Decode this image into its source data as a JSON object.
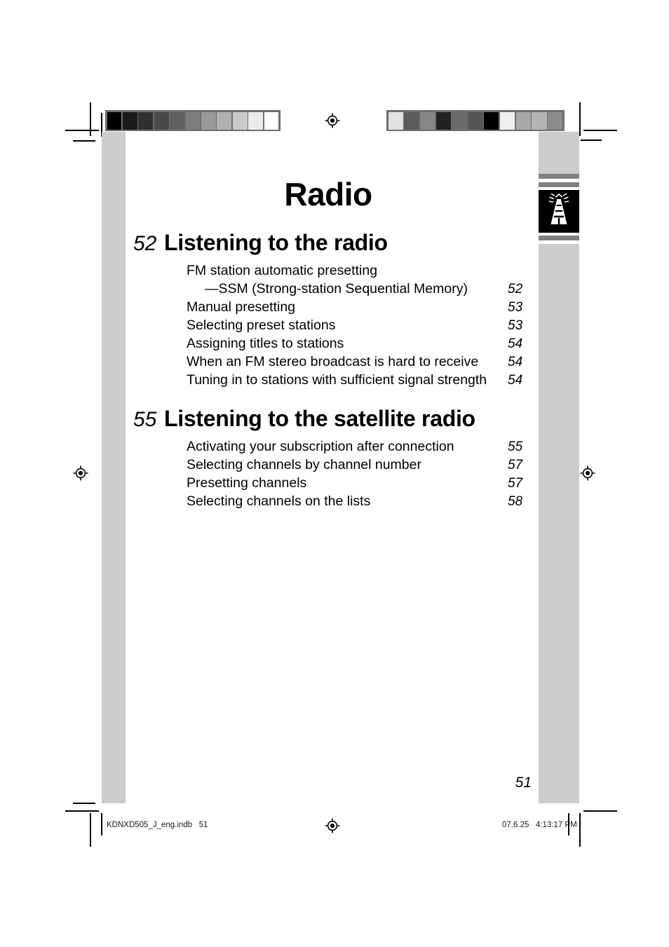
{
  "document": {
    "title": "Radio",
    "folio": "51"
  },
  "index_tab": {
    "icon": "radio-antenna-tower-icon"
  },
  "sections": [
    {
      "number": "52",
      "title": "Listening to the radio",
      "entries": [
        {
          "label": "FM station automatic presetting",
          "page": "",
          "indent": false
        },
        {
          "label": "—SSM (Strong-station Sequential Memory)",
          "page": "52",
          "indent": true
        },
        {
          "label": "Manual presetting",
          "page": "53",
          "indent": false
        },
        {
          "label": "Selecting preset stations",
          "page": "53",
          "indent": false
        },
        {
          "label": "Assigning titles to stations",
          "page": "54",
          "indent": false
        },
        {
          "label": "When an FM stereo broadcast is hard to receive",
          "page": "54",
          "indent": false
        },
        {
          "label": "Tuning in to stations with sufficient signal strength",
          "page": "54",
          "indent": false
        }
      ]
    },
    {
      "number": "55",
      "title": "Listening to the satellite radio",
      "entries": [
        {
          "label": "Activating your subscription after connection",
          "page": "55",
          "indent": false
        },
        {
          "label": "Selecting channels by channel number",
          "page": "57",
          "indent": false
        },
        {
          "label": "Presetting channels",
          "page": "57",
          "indent": false
        },
        {
          "label": "Selecting channels on the lists",
          "page": "58",
          "indent": false
        }
      ]
    }
  ],
  "print_footer": {
    "file": "KDNXD505_J_eng.indb   51",
    "timestamp": "07.6.25   4:13:17 PM"
  },
  "calibration": {
    "left_bar": [
      "#000000",
      "#1a1a1a",
      "#303030",
      "#4a4a4a",
      "#616161",
      "#7d7d7d",
      "#989898",
      "#b0b0b0",
      "#c9c9c9",
      "#ececec",
      "#ffffff"
    ],
    "right_bar": [
      "#e2e2e2",
      "#5c5c5c",
      "#868686",
      "#222222",
      "#6b6b6b",
      "#565656",
      "#000000",
      "#efefef",
      "#a8a8a8",
      "#b4b4b4",
      "#8c8c8c"
    ]
  },
  "colors": {
    "margin_gray": "#cccccc",
    "tab_stripe_gray": "#808080",
    "ink_black": "#000000"
  }
}
